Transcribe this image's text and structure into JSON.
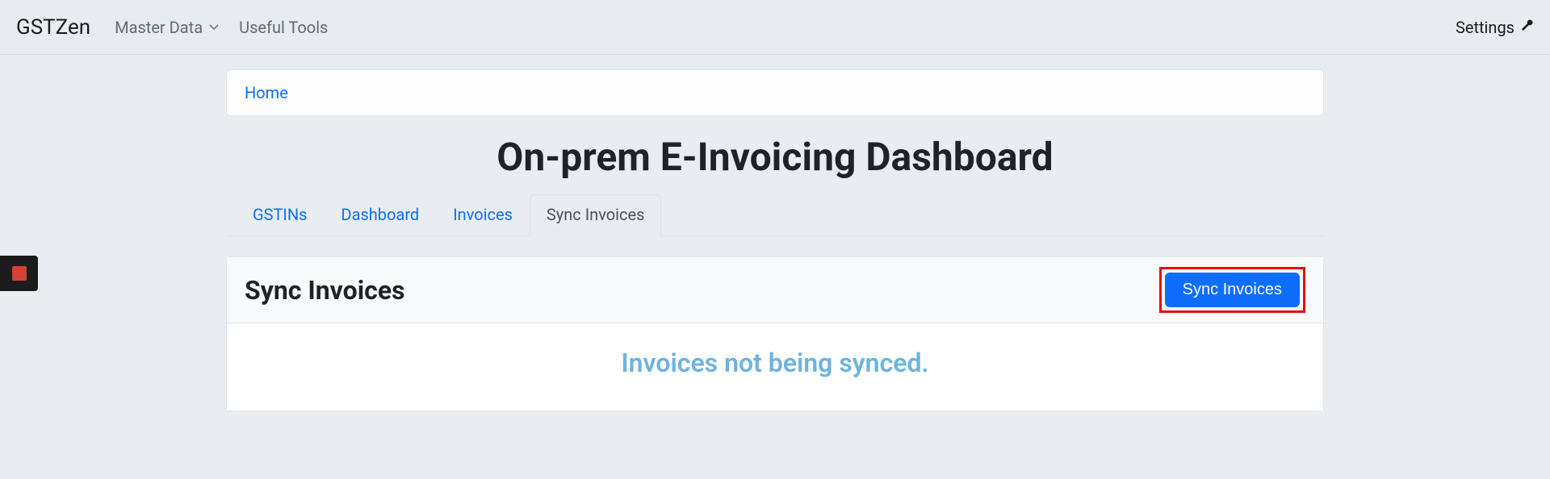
{
  "navbar": {
    "brand": "GSTZen",
    "master_data": "Master Data",
    "useful_tools": "Useful Tools",
    "settings": "Settings"
  },
  "breadcrumb": {
    "home": "Home"
  },
  "page_title": "On-prem E-Invoicing Dashboard",
  "tabs": [
    {
      "label": "GSTINs",
      "active": false
    },
    {
      "label": "Dashboard",
      "active": false
    },
    {
      "label": "Invoices",
      "active": false
    },
    {
      "label": "Sync Invoices",
      "active": true
    }
  ],
  "panel": {
    "title": "Sync Invoices",
    "button_label": "Sync Invoices",
    "status": "Invoices not being synced."
  },
  "colors": {
    "link": "#0d6efd",
    "status_text": "#6bb4e0",
    "highlight_border": "#e11113"
  }
}
